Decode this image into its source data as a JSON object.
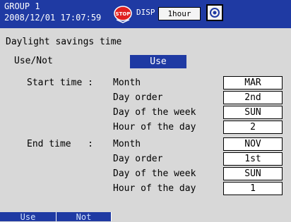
{
  "header": {
    "group_label": "GROUP 1",
    "datetime": "2008/12/01 17:07:59",
    "disp_label": "DISP",
    "interval": "1hour",
    "stop_icon": "stop-icon",
    "monitor_icon": "monitor-icon",
    "colors": {
      "bar": "#1f3aa3",
      "stop": "#e02020"
    }
  },
  "title": "Daylight savings time",
  "use_not": {
    "label": "Use/Not",
    "value": "Use"
  },
  "start_time": {
    "label": "Start time :",
    "fields": [
      {
        "label": "Month",
        "value": "MAR"
      },
      {
        "label": "Day order",
        "value": "2nd"
      },
      {
        "label": "Day of the week",
        "value": "SUN"
      },
      {
        "label": "Hour of the day",
        "value": "2"
      }
    ]
  },
  "end_time": {
    "label": "End time   :",
    "fields": [
      {
        "label": "Month",
        "value": "NOV"
      },
      {
        "label": "Day order",
        "value": "1st"
      },
      {
        "label": "Day of the week",
        "value": "SUN"
      },
      {
        "label": "Hour of the day",
        "value": "1"
      }
    ]
  },
  "softkeys": [
    {
      "label": "Use"
    },
    {
      "label": "Not"
    }
  ]
}
